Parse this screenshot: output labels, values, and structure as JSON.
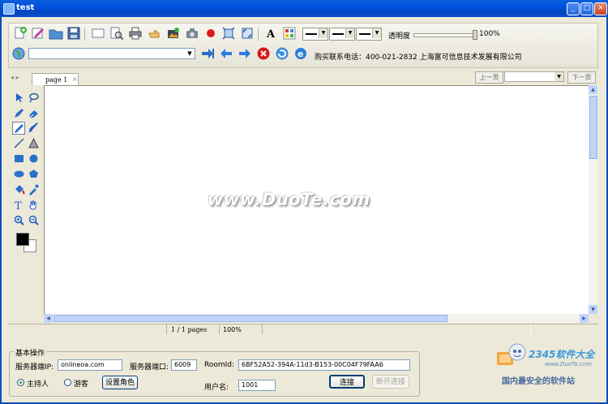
{
  "window": {
    "title": "test"
  },
  "toolbar": {
    "opacity_label": "透明度",
    "opacity_value": "100%",
    "opacity_level": 1.0
  },
  "address": {
    "value": ""
  },
  "contact": {
    "text": "购买联系电话：400-021-2832   上海富可信息技术发展有限公司"
  },
  "tabs": {
    "arrows": "◂ ▸",
    "items": [
      {
        "label": "page 1",
        "close": "×"
      }
    ],
    "prev_page": "上一页",
    "next_page": "下一页",
    "page_select": ""
  },
  "canvas": {
    "watermark": "www.DuoTe.com"
  },
  "status": {
    "pages": "1 / 1 pages",
    "zoom": "100%"
  },
  "basic": {
    "legend": "基本操作",
    "server_ip_label": "服务器端IP:",
    "server_ip_value": "onlineoa.com",
    "server_port_label": "服务器端口:",
    "server_port_value": "6009",
    "room_id_label": "RoomId:",
    "room_id_value": "6BF52A52-394A-11d3-B153-00C04F79FAA6",
    "role_host": "主持人",
    "role_guest": "游客",
    "set_role_button": "设置角色",
    "username_label": "用户名:",
    "username_value": "1001",
    "connect_button": "连接",
    "disconnect_button": "断开连接"
  },
  "brand": {
    "name": "2345软件大全",
    "url": "www.DuoTe.com",
    "slogan": "国内最安全的软件站"
  },
  "colors": {
    "titlebar": "#0a5fd8",
    "foreground": "#000000",
    "background": "#ffffff",
    "scroll_thumb": "#c1d3fb"
  }
}
